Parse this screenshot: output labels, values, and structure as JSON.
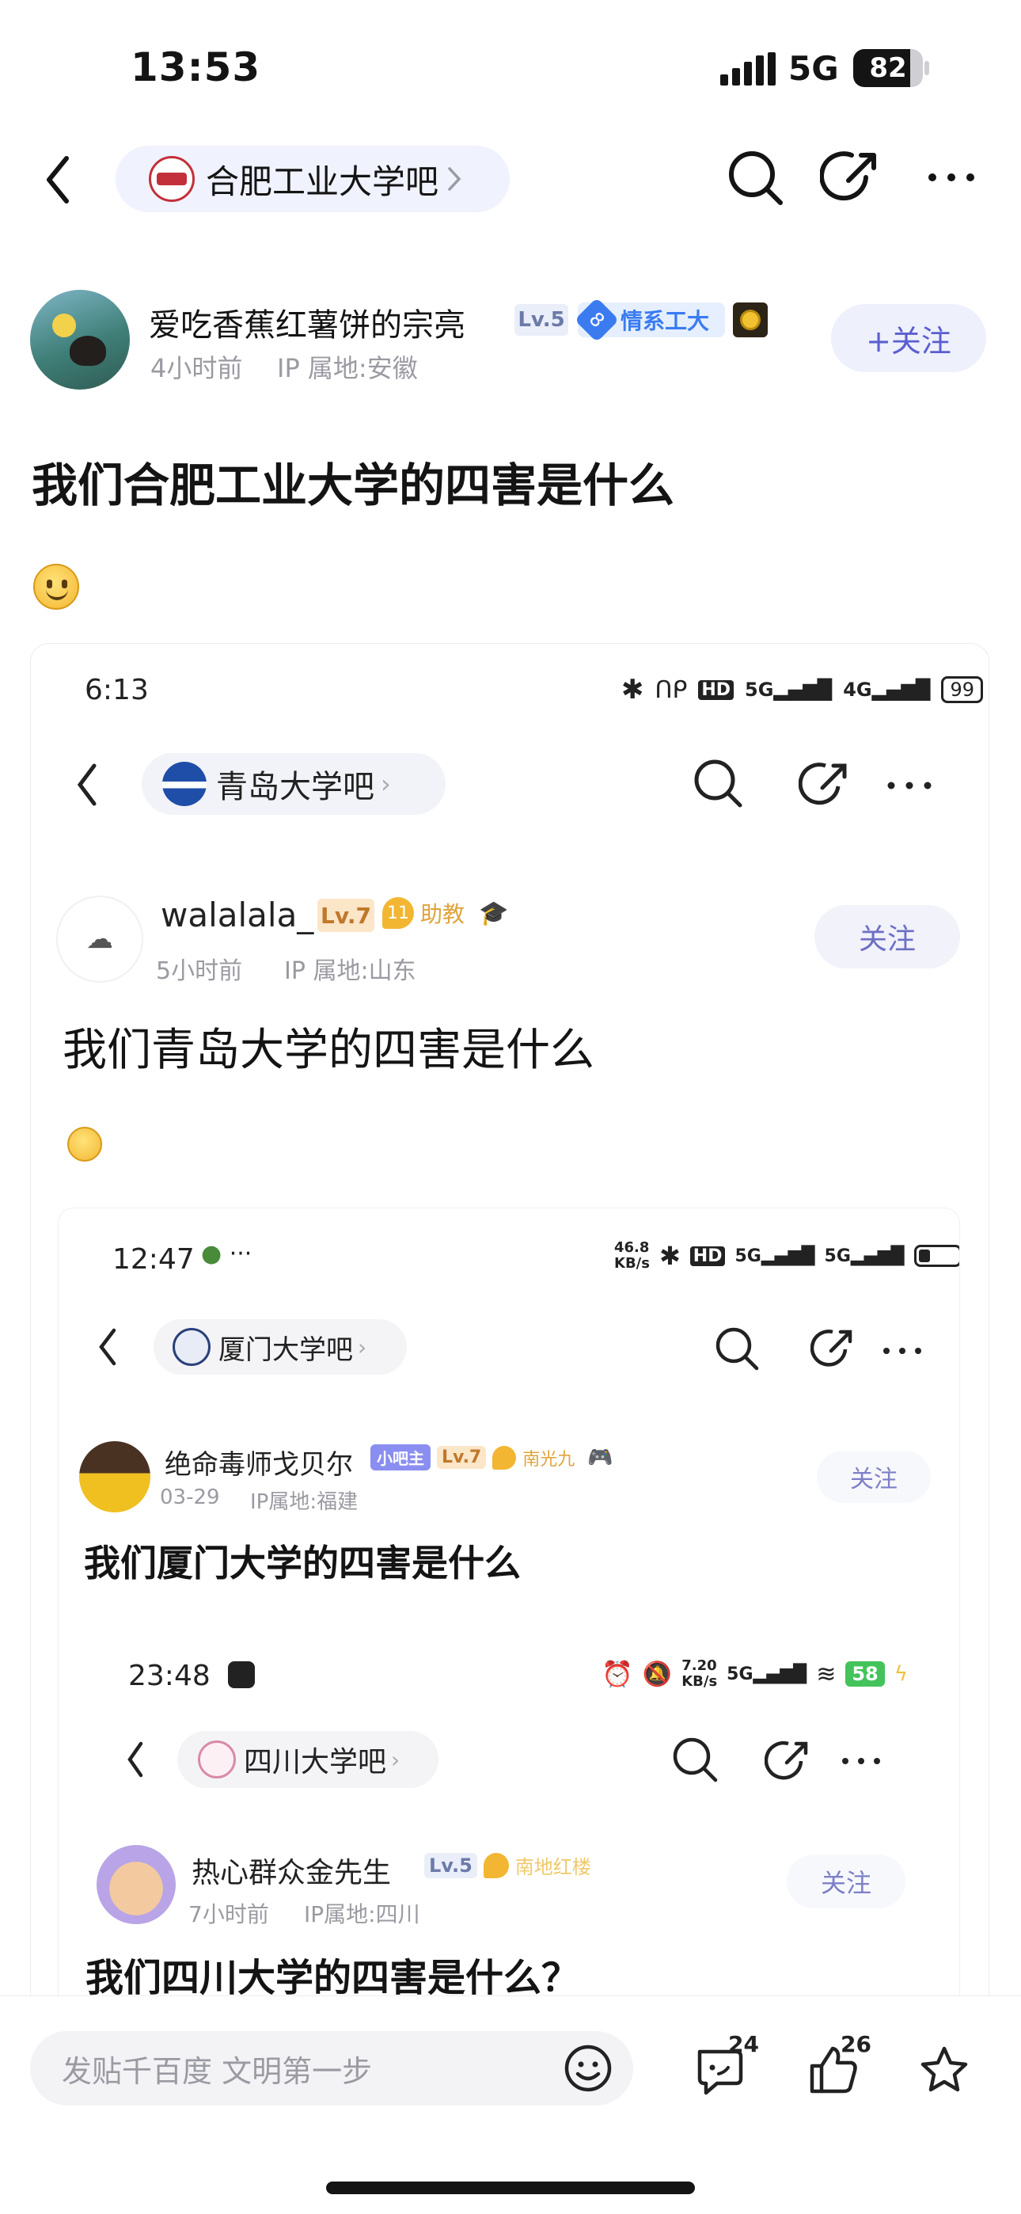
{
  "status_bar": {
    "time": "13:53",
    "network": "5G",
    "battery": "82"
  },
  "header": {
    "forum_name": "合肥工业大学吧"
  },
  "post": {
    "author": {
      "name": "爱吃香蕉红薯饼的宗亮",
      "level": "Lv.5",
      "badge_num": "8",
      "badge_text": "情系工大",
      "time": "4小时前",
      "ip": "IP 属地:安徽"
    },
    "follow_label": "+关注",
    "title": "我们合肥工业大学的四害是什么"
  },
  "screenshot1": {
    "status_time": "6:13",
    "battery": "99",
    "forum_name": "青岛大学吧",
    "author": "walalala_",
    "level": "Lv.7",
    "badge_num": "11",
    "badge_text": "助教",
    "time": "5小时前",
    "ip": "IP 属地:山东",
    "follow_label": "关注",
    "title": "我们青岛大学的四害是什么"
  },
  "screenshot2": {
    "status_time": "12:47",
    "speed_top": "46.8",
    "speed_bottom": "KB/s",
    "forum_name": "厦门大学吧",
    "author": "绝命毒师戈贝尔",
    "role": "小吧主",
    "level": "Lv.7",
    "badge_text": "南光九",
    "time": "03-29",
    "ip": "IP属地:福建",
    "follow_label": "关注",
    "title": "我们厦门大学的四害是什么"
  },
  "screenshot3": {
    "status_time": "23:48",
    "speed_top": "7.20",
    "speed_bottom": "KB/s",
    "battery": "58",
    "forum_name": "四川大学吧",
    "author": "热心群众金先生",
    "level": "Lv.5",
    "badge_text": "南地红楼",
    "time": "7小时前",
    "ip": "IP属地:四川",
    "follow_label": "关注",
    "title": "我们四川大学的四害是什么？"
  },
  "bottom_bar": {
    "input_placeholder": "发贴千百度 文明第一步",
    "comment_count": "24",
    "like_count": "26"
  },
  "colors": {
    "follow_bg": "#eef0fc",
    "follow_text": "#5b5fcf",
    "forum_pill_bg": "#f0f2fe",
    "badge_blue": "#3a7cf0"
  }
}
